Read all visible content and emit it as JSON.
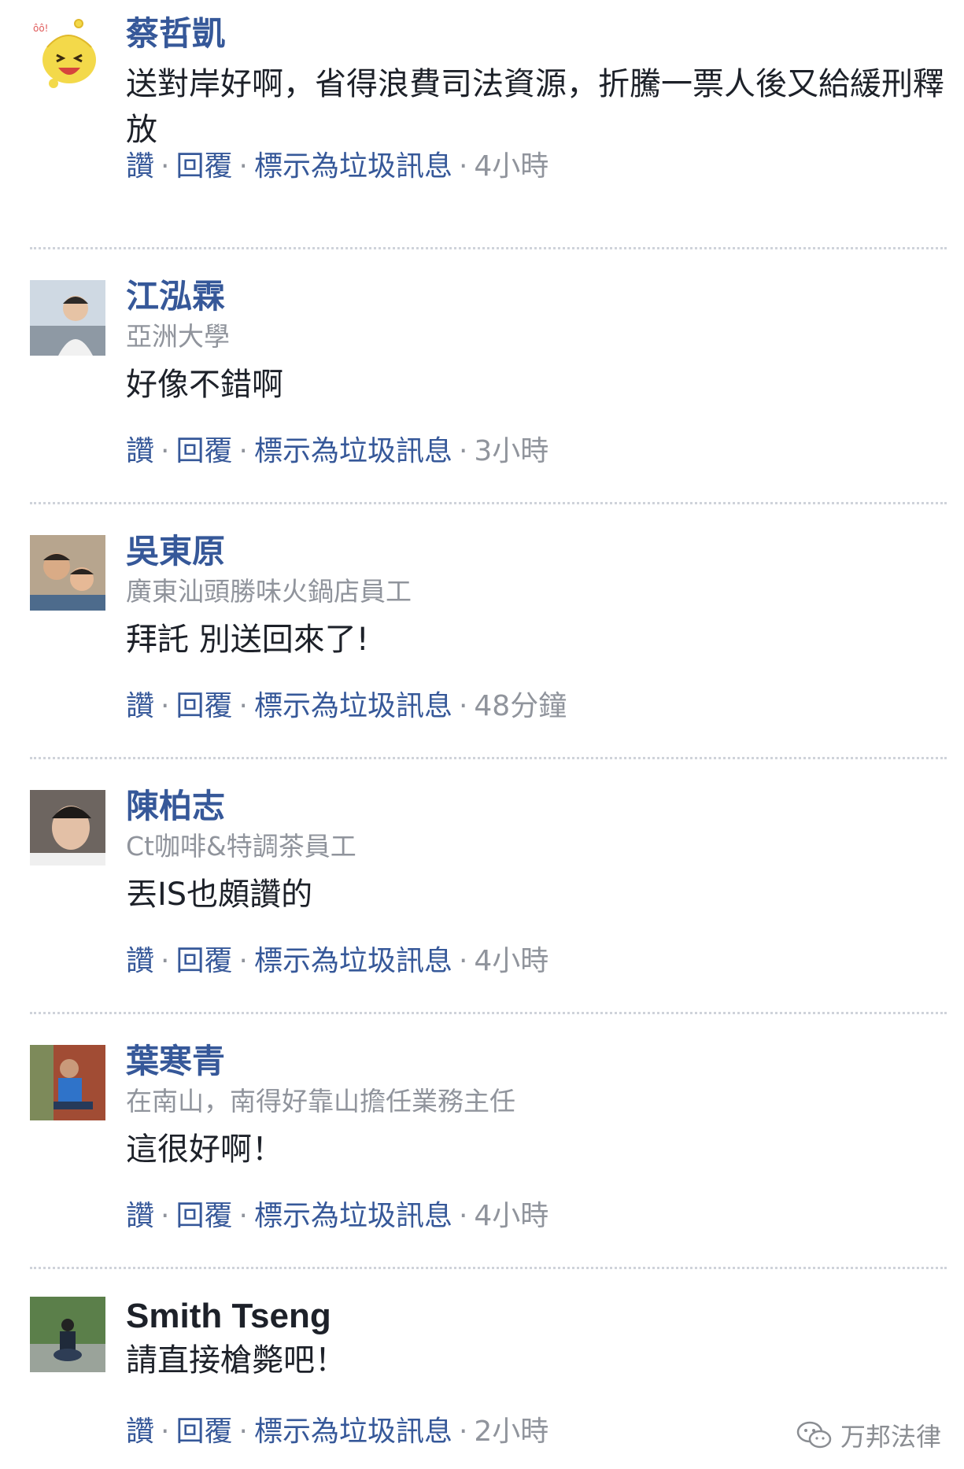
{
  "comments": [
    {
      "name": "蔡哲凱",
      "subtitle": "",
      "text": "送對岸好啊，省得浪費司法資源，折騰一票人後又給緩刑釋放",
      "actions": [
        "讚",
        "回覆",
        "標示為垃圾訊息"
      ],
      "time": "4小時",
      "avatar": "cartoon-avatar"
    },
    {
      "name": "江泓霖",
      "subtitle": "亞洲大學",
      "text": "好像不錯啊",
      "actions": [
        "讚",
        "回覆",
        "標示為垃圾訊息"
      ],
      "time": "3小時",
      "avatar": "photo-avatar"
    },
    {
      "name": "吳東原",
      "subtitle": "廣東汕頭勝味火鍋店員工",
      "text": "拜託 別送回來了!",
      "actions": [
        "讚",
        "回覆",
        "標示為垃圾訊息"
      ],
      "time": "48分鐘",
      "avatar": "photo-avatar"
    },
    {
      "name": "陳柏志",
      "subtitle": "Ct咖啡&特調茶員工",
      "text": "丟IS也頗讚的",
      "actions": [
        "讚",
        "回覆",
        "標示為垃圾訊息"
      ],
      "time": "4小時",
      "avatar": "photo-avatar"
    },
    {
      "name": "葉寒青",
      "subtitle": "在南山，南得好靠山擔任業務主任",
      "text": "這很好啊！",
      "actions": [
        "讚",
        "回覆",
        "標示為垃圾訊息"
      ],
      "time": "4小時",
      "avatar": "photo-avatar"
    },
    {
      "name": "Smith Tseng",
      "subtitle": "",
      "text": "請直接槍斃吧！",
      "actions": [
        "讚",
        "回覆",
        "標示為垃圾訊息"
      ],
      "time": "2小時",
      "avatar": "photo-avatar"
    }
  ],
  "watermark": {
    "label": "万邦法律",
    "icon": "wechat-icon"
  },
  "colors": {
    "link": "#365899",
    "meta": "#90949c",
    "text": "#1d2129"
  }
}
